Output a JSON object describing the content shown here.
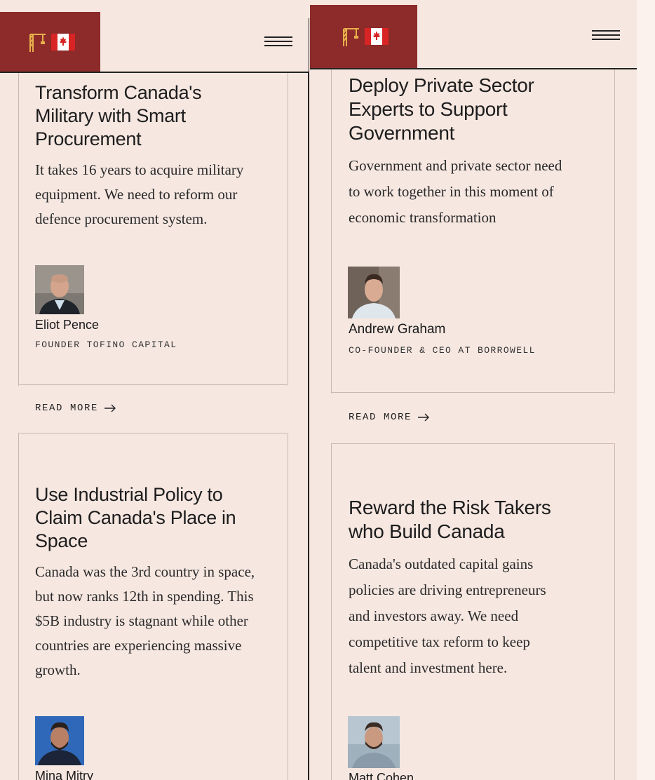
{
  "icons": {
    "logo": [
      "crane-icon",
      "canada-flag-icon"
    ],
    "menu": "hamburger-menu-icon",
    "arrow": "arrow-right-icon"
  },
  "colors": {
    "background": "#f6e7e1",
    "brand": "#8d2a2a",
    "text": "#1d1d1d",
    "rule": "#cbb8b0"
  },
  "left": {
    "card1": {
      "title_lines": [
        "Transform Canada's",
        "Military with Smart",
        "Procurement"
      ],
      "desc_lines": [
        "It takes 16 years to acquire military",
        "equipment. We need to reform our",
        "defence procurement system."
      ],
      "author_name": "Eliot Pence",
      "author_role": "FOUNDER TOFINO CAPITAL",
      "read_more": "READ MORE"
    },
    "card2": {
      "title_lines": [
        "Use Industrial Policy to",
        "Claim Canada's Place in",
        "Space"
      ],
      "desc_lines": [
        "Canada was the 3rd country in space,",
        "but now ranks 12th in spending. This",
        "$5B industry is stagnant while other",
        "countries are experiencing massive",
        "growth."
      ],
      "author_name": "Mina Mitry"
    }
  },
  "right": {
    "card1": {
      "title_lines": [
        "Deploy Private Sector",
        "Experts to Support",
        "Government"
      ],
      "desc_lines": [
        "Government and private sector need",
        "to work together in this moment of",
        "economic transformation"
      ],
      "author_name": "Andrew Graham",
      "author_role": "CO-FOUNDER & CEO AT BORROWELL",
      "read_more": "READ MORE"
    },
    "card2": {
      "title_lines": [
        "Reward the Risk Takers",
        "who Build Canada"
      ],
      "desc_lines": [
        "Canada's outdated capital gains",
        "policies are driving entrepreneurs",
        "and investors away. We need",
        "competitive tax reform to keep",
        "talent and investment here."
      ],
      "author_name": "Matt Cohen"
    }
  }
}
